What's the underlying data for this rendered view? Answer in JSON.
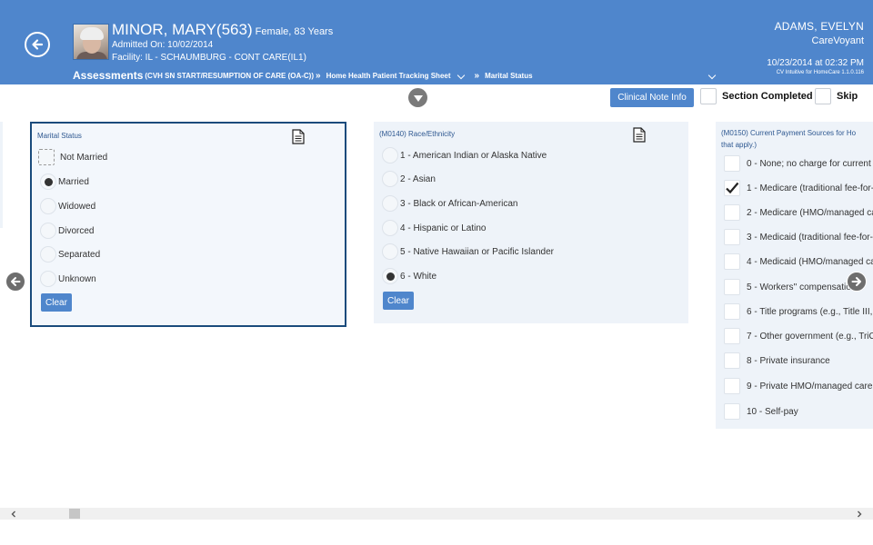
{
  "header": {
    "patient": {
      "name": "MINOR, MARY(563)",
      "demographics": "Female, 83 Years",
      "admitted": "Admitted On: 10/02/2014",
      "facility": "Facility: IL - SCHAUMBURG - CONT CARE(IL1)"
    },
    "breadcrumb": {
      "title": "Assessments",
      "subtitle": "(CVH SN START/RESUMPTION OF CARE (OA-C))",
      "sheet": "Home Health Patient Tracking Sheet",
      "section": "Marital Status"
    },
    "user": {
      "name": "ADAMS, EVELYN",
      "org": "CareVoyant",
      "datetime": "10/23/2014 at 02:32 PM",
      "version": "CV Intuitive for HomeCare 1.1.0.116"
    }
  },
  "toolbar": {
    "clinical_note_label": "Clinical Note Info",
    "section_completed_label": "Section Completed",
    "skip_label": "Skip"
  },
  "cards": {
    "marital": {
      "title": "Marital Status",
      "options": [
        "Not Married",
        "Married",
        "Widowed",
        "Divorced",
        "Separated",
        "Unknown"
      ],
      "selected": "Married",
      "clear_label": "Clear"
    },
    "race": {
      "title": "(M0140) Race/Ethnicity",
      "options": [
        "1 - American Indian or Alaska Native",
        "2 - Asian",
        "3 - Black or African-American",
        "4 - Hispanic or Latino",
        "5 - Native Hawaiian or Pacific Islander",
        "6 - White"
      ],
      "selected": "6 - White",
      "clear_label": "Clear"
    },
    "payment": {
      "title_line1": "(M0150) Current Payment Sources for Ho",
      "title_line2": "that apply.)",
      "options": [
        "0 - None; no charge for current",
        "1 - Medicare (traditional fee-for-",
        "2 - Medicare (HMO/managed ca",
        "3 - Medicaid (traditional fee-for-",
        "4 - Medicaid (HMO/managed ca",
        "5 - Workers'' compensatio",
        "6 - Title programs (e.g., Title III,",
        "7 - Other government (e.g., TriC",
        "8 - Private insurance",
        "9 - Private HMO/managed care",
        "10 - Self-pay"
      ],
      "checked": [
        "1 - Medicare (traditional fee-for-"
      ]
    }
  },
  "colors": {
    "header_bg": "#4f86cc",
    "card_bg": "#eef3f9",
    "selected_border": "#1a4b7c",
    "title_text": "#2d5790"
  }
}
